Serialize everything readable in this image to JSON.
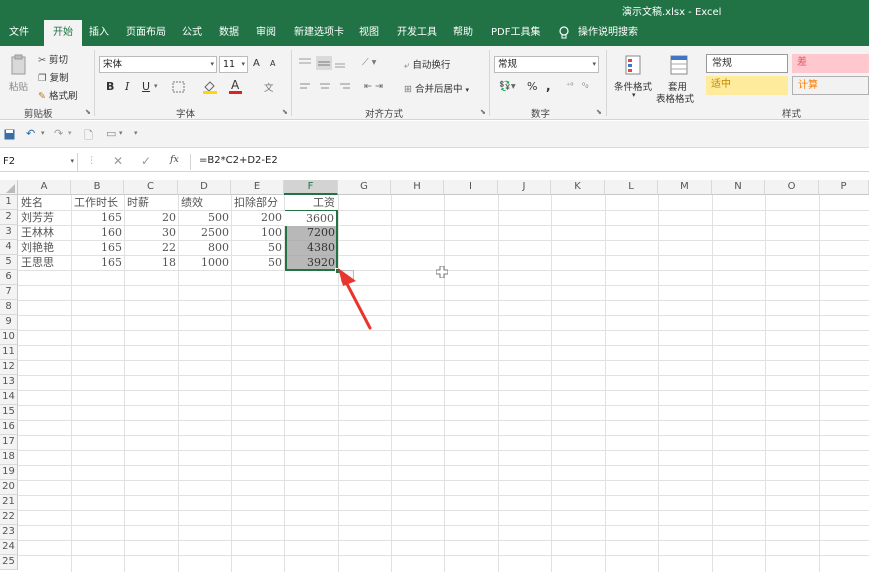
{
  "window": {
    "title": "演示文稿.xlsx  -  Excel"
  },
  "tabs": [
    "文件",
    "开始",
    "插入",
    "页面布局",
    "公式",
    "数据",
    "审阅",
    "新建选项卡",
    "视图",
    "开发工具",
    "帮助",
    "PDF工具集"
  ],
  "tab_active": "开始",
  "tell_me": "操作说明搜索",
  "ribbon": {
    "clipboard": {
      "paste": "粘贴",
      "cut": "剪切",
      "copy": "复制",
      "format_painter": "格式刷",
      "label": "剪贴板"
    },
    "font": {
      "name": "宋体",
      "size": "11",
      "bold": "B",
      "italic": "I",
      "underline": "U",
      "grow": "A",
      "shrink": "A",
      "font_color": "A",
      "label": "字体"
    },
    "alignment": {
      "wrap": "自动换行",
      "merge": "合并后居中",
      "label": "对齐方式"
    },
    "number": {
      "format": "常规",
      "percent": "%",
      "comma": ",",
      "label": "数字"
    },
    "styles": {
      "conditional": "条件格式",
      "table_line1": "套用",
      "table_line2": "表格格式",
      "normal": "常规",
      "bad": "差",
      "good": "适中",
      "calc": "计算",
      "label": "样式",
      "colors": {
        "bad_bg": "#ffc7ce",
        "bad_fg": "#e05a6a",
        "good_bg": "#ffeb9c",
        "good_fg": "#9c6500",
        "calc_fg": "#fa7d00"
      }
    }
  },
  "formula_bar": {
    "name_box": "F2",
    "fx": "fx",
    "formula": "=B2*C2+D2-E2"
  },
  "sheet": {
    "columns": [
      "A",
      "B",
      "C",
      "D",
      "E",
      "F",
      "G",
      "H",
      "I",
      "J",
      "K",
      "L",
      "M",
      "N",
      "O",
      "P"
    ],
    "selected_column": "F",
    "rows": [
      "1",
      "2",
      "3",
      "4",
      "5",
      "6",
      "7",
      "8",
      "9",
      "10",
      "11",
      "12",
      "13",
      "14",
      "15",
      "16",
      "17",
      "18",
      "19",
      "20",
      "21",
      "22",
      "23",
      "24",
      "25"
    ],
    "header": [
      "姓名",
      "工作时长",
      "时薪",
      "绩效",
      "扣除部分",
      "工资"
    ],
    "data": [
      [
        "刘芳芳",
        "165",
        "20",
        "500",
        "200",
        "3600"
      ],
      [
        "王林林",
        "160",
        "30",
        "2500",
        "100",
        "7200"
      ],
      [
        "刘艳艳",
        "165",
        "22",
        "800",
        "50",
        "4380"
      ],
      [
        "王思思",
        "165",
        "18",
        "1000",
        "50",
        "3920"
      ]
    ],
    "selection_range": "F2:F5",
    "accent_color": "#217346",
    "annotation_arrow_color": "#e8352d"
  }
}
